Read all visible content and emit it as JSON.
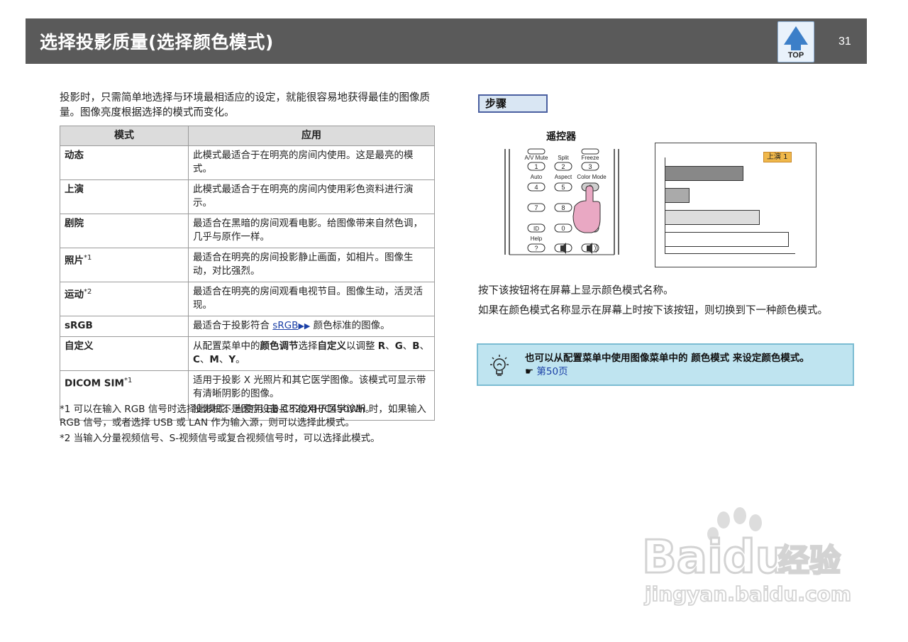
{
  "header": {
    "title": "选择投影质量(选择颜色模式)",
    "top_label": "TOP",
    "page_number": "31"
  },
  "intro": "投影时，只需简单地选择与环境最相适应的设定，就能很容易地获得最佳的图像质量。图像亮度根据选择的模式而变化。",
  "table": {
    "col_mode": "模式",
    "col_use": "应用",
    "rows": [
      {
        "mode": "动态",
        "note": "",
        "desc": "此模式最适合于在明亮的房间内使用。这是最亮的模式。"
      },
      {
        "mode": "上演",
        "note": "",
        "desc": "此模式最适合于在明亮的房间内使用彩色资料进行演示。"
      },
      {
        "mode": "剧院",
        "note": "",
        "desc": "最适合在黑暗的房间观看电影。给图像带来自然色调，几乎与原作一样。"
      },
      {
        "mode": "照片",
        "note": "*1",
        "desc": "最适合在明亮的房间投影静止画面，如相片。图像生动，对比强烈。"
      },
      {
        "mode": "运动",
        "note": "*2",
        "desc": "最适合在明亮的房间观看电视节目。图像生动，活灵活现。"
      }
    ],
    "srgb": {
      "mode": "sRGB",
      "desc_before": "最适合于投影符合 ",
      "link": "sRGB",
      "desc_after": " 颜色标准的图像。"
    },
    "custom": {
      "mode": "自定义",
      "t1": "从配置菜单中的",
      "b1": "颜色调节",
      "t2": "选择",
      "b2": "自定义",
      "t3": "以调整 ",
      "b3": "R",
      "s1": "、",
      "b4": "G",
      "s2": "、",
      "b5": "B",
      "s3": "、",
      "b6": "C",
      "s4": "、",
      "b7": "M",
      "s5": "、",
      "b8": "Y",
      "end": "。"
    },
    "dicom": {
      "mode": "DICOM SIM",
      "note": "*1",
      "desc1": "适用于投影 X 光照片和其它医学图像。该模式可显示带有清晰阴影的图像。",
      "desc2": "投影机不是医疗设备且不能用于医学诊断。"
    }
  },
  "footnotes": [
    "*1 可以在输入 RGB 信号时选择此模式。当使用 EB-C520XH/C450WH 时，如果输入 RGB 信号，或者选择 USB 或 LAN 作为输入源，则可以选择此模式。",
    "*2 当输入分量视频信号、S-视频信号或复合视频信号时，可以选择此模式。"
  ],
  "procedure": {
    "step_label": "步骤",
    "remote_label": "遥控器",
    "remote_keys": {
      "av_mute": "A/V Mute",
      "split": "Split",
      "freeze": "Freeze",
      "k1": "1",
      "k2": "2",
      "k3": "3",
      "auto": "Auto",
      "aspect": "Aspect",
      "color_mode": "Color Mode",
      "k4": "4",
      "k5": "5",
      "k6": "6",
      "k7": "7",
      "k8": "8",
      "id": "ID",
      "k0": "0",
      "help": "Help",
      "q": "?"
    },
    "screen_tag": "上演 1",
    "text1": "按下该按钮将在屏幕上显示颜色模式名称。",
    "text2": "如果在颜色模式名称显示在屏幕上时按下该按钮，则切换到下一种颜色模式。"
  },
  "tip": {
    "text": "也可以从配置菜单中使用图像菜单中的 颜色模式 来设定颜色模式。",
    "hand": "☛",
    "page_link": "第50页"
  },
  "watermark": {
    "brand": "Baidu",
    "cn": "经验",
    "url": "jingyan.baidu.com"
  }
}
